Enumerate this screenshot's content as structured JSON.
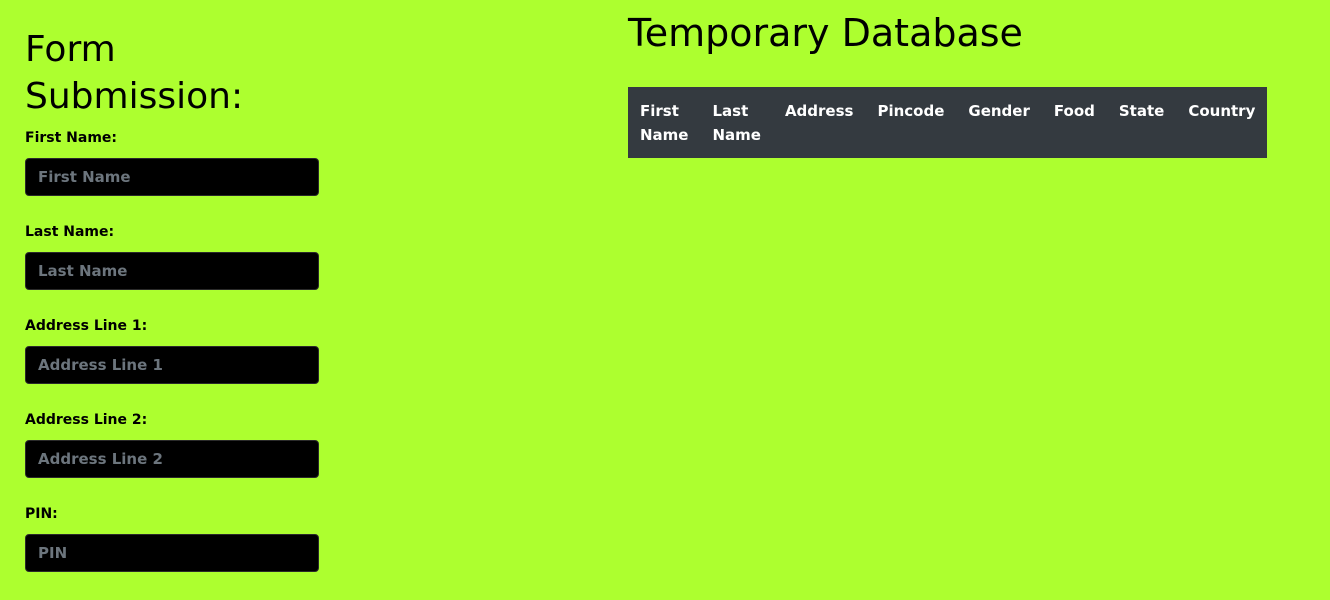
{
  "form": {
    "title": "Form Submission:",
    "fields": [
      {
        "label": "First Name:",
        "placeholder": "First Name",
        "value": ""
      },
      {
        "label": "Last Name:",
        "placeholder": "Last Name",
        "value": ""
      },
      {
        "label": "Address Line 1:",
        "placeholder": "Address Line 1",
        "value": ""
      },
      {
        "label": "Address Line 2:",
        "placeholder": "Address Line 2",
        "value": ""
      },
      {
        "label": "PIN:",
        "placeholder": "PIN",
        "value": ""
      }
    ]
  },
  "database": {
    "title": "Temporary Database",
    "columns": [
      "First Name",
      "Last Name",
      "Address",
      "Pincode",
      "Gender",
      "Food",
      "State",
      "Country"
    ],
    "rows": []
  },
  "colors": {
    "background": "#adff2f",
    "input_background": "#000000",
    "placeholder": "#6c757d",
    "table_header_background": "#343a40",
    "table_header_text": "#ffffff"
  }
}
